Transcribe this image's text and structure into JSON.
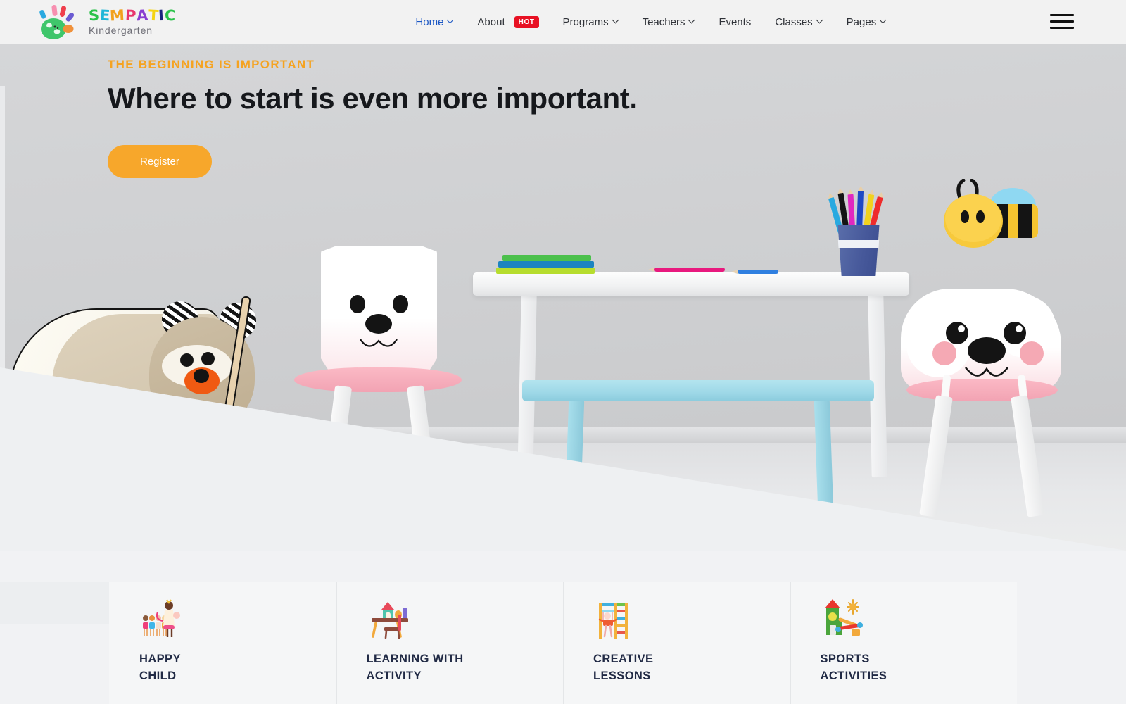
{
  "brand": {
    "name": "SEMPATIC",
    "subtitle": "Kindergarten",
    "letters": [
      {
        "ch": "S",
        "color": "#2bc24a"
      },
      {
        "ch": "E",
        "color": "#1fb6d8"
      },
      {
        "ch": "M",
        "color": "#f2a11c"
      },
      {
        "ch": "P",
        "color": "#e8356d"
      },
      {
        "ch": "A",
        "color": "#8a3fd1"
      },
      {
        "ch": "T",
        "color": "#f5d416"
      },
      {
        "ch": "I",
        "color": "#1a237e"
      },
      {
        "ch": "C",
        "color": "#2bc24a"
      }
    ],
    "logo_icon": "handprint-palette-icon"
  },
  "nav": {
    "items": [
      {
        "label": "Home",
        "has_caret": true,
        "active": true,
        "badge": null
      },
      {
        "label": "About",
        "has_caret": false,
        "active": false,
        "badge": "HOT"
      },
      {
        "label": "Programs",
        "has_caret": true,
        "active": false,
        "badge": null
      },
      {
        "label": "Teachers",
        "has_caret": true,
        "active": false,
        "badge": null
      },
      {
        "label": "Events",
        "has_caret": false,
        "active": false,
        "badge": null
      },
      {
        "label": "Classes",
        "has_caret": true,
        "active": false,
        "badge": null
      },
      {
        "label": "Pages",
        "has_caret": true,
        "active": false,
        "badge": null
      }
    ],
    "active_color": "#1a56c4",
    "badge_color": "#e81123",
    "menu_icon": "hamburger-menu-icon"
  },
  "hero": {
    "kicker": "THE BEGINNING IS IMPORTANT",
    "headline": "Where to start is even more important.",
    "cta_label": "Register",
    "kicker_color": "#f5a321",
    "cta_color": "#f7a72b",
    "scene_items": [
      "toy-pram-with-bear",
      "bunny-pillow-chair",
      "white-table-with-books-and-pencils",
      "blue-bench",
      "pencil-cup",
      "cloud-bear-chair",
      "cartoon-bee"
    ]
  },
  "features": {
    "cards": [
      {
        "title_line1": "HAPPY",
        "title_line2": "CHILD",
        "icon": "teacher-with-children-icon"
      },
      {
        "title_line1": "LEARNING WITH",
        "title_line2": "ACTIVITY",
        "icon": "desk-with-blocks-icon"
      },
      {
        "title_line1": "CREATIVE",
        "title_line2": "LESSONS",
        "icon": "swing-and-ladder-icon"
      },
      {
        "title_line1": "SPORTS",
        "title_line2": "ACTIVITIES",
        "icon": "playground-slide-icon"
      }
    ],
    "title_color": "#212a45"
  }
}
